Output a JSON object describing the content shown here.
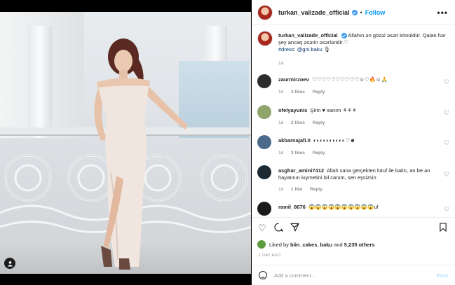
{
  "post": {
    "username": "turkan_valizade_official",
    "follow_label": "Follow",
    "separator": "•",
    "more": "•••"
  },
  "caption": {
    "username": "turkan_valizade_official",
    "text": "Allahın ən gözəl əsəri könüldür. Qalan hər şey ancaq əsərin əsərləridir.♡",
    "hashtag": "#dress",
    "mention": "@gni.baku",
    "emoji": "🎙",
    "time": "1d"
  },
  "comments": [
    {
      "username": "zaurmirzoev",
      "text": "♡♡♡♡♡♡♡♡♡♡☺♡🔥☺🙏",
      "time": "1d",
      "likes": "3 likes",
      "reply": "Reply",
      "avatar_color": "#2c2c2c"
    },
    {
      "username": "ofelyayunis",
      "text": "Şirin ♥ xanım ⚘⚘⚘",
      "time": "1d",
      "likes": "2 likes",
      "reply": "Reply",
      "avatar_color": "#8fa66a"
    },
    {
      "username": "akbarnajafi.0",
      "text": "◐◐◐◐◐◐◐◐◐◐♡☻",
      "time": "1d",
      "likes": "3 likes",
      "reply": "Reply",
      "avatar_color": "#4c6a8a"
    },
    {
      "username": "asghar_amini7412",
      "text": "Allah sana gerçekten lütuf ile baktı, an be an hayatının kıymetini bil canım, sen eşsizsin",
      "time": "1d",
      "likes": "1 like",
      "reply": "Reply",
      "avatar_color": "#1d2a33"
    },
    {
      "username": "ramil_8676",
      "text": "😱😱😱😱😱😱😱😱😱😱uf",
      "time": "",
      "likes": "",
      "reply": "",
      "avatar_color": "#1a1a1a"
    }
  ],
  "likes": {
    "prefix": "Liked by",
    "user": "blin_cakes_baku",
    "and": "and",
    "count": "5,235 others"
  },
  "posted": "1 DAY AGO",
  "comment_box": {
    "placeholder": "Add a comment...",
    "post_label": "Post"
  },
  "icons": {
    "like": "heart-icon",
    "comment": "comment-icon",
    "share": "share-icon",
    "save": "bookmark-icon",
    "more": "more-options-icon",
    "emoji": "emoji-icon",
    "tag": "user-tag-icon"
  }
}
